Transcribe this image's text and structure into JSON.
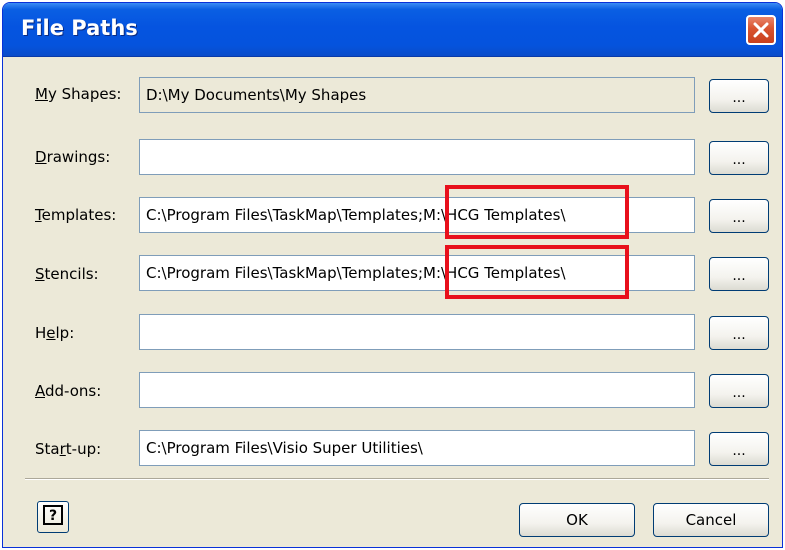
{
  "window": {
    "title": "File Paths"
  },
  "rows": [
    {
      "label": "My Shapes:",
      "value": "D:\\My Documents\\My Shapes",
      "browse": "...",
      "readonly": true
    },
    {
      "label": "Drawings:",
      "value": "",
      "browse": "..."
    },
    {
      "label": "Templates:",
      "value": "C:\\Program Files\\TaskMap\\Templates;M:\\HCG Templates\\",
      "browse": "...",
      "highlight_text": "M:\\HCG Templates\\"
    },
    {
      "label": "Stencils:",
      "value": "C:\\Program Files\\TaskMap\\Templates;M:\\HCG Templates\\",
      "browse": "...",
      "highlight_text": "M:\\HCG Templates\\"
    },
    {
      "label": "Help:",
      "value": "",
      "browse": "..."
    },
    {
      "label": "Add-ons:",
      "value": "",
      "browse": "..."
    },
    {
      "label": "Start-up:",
      "value": "C:\\Program Files\\Visio Super Utilities\\",
      "browse": "..."
    }
  ],
  "buttons": {
    "ok": "OK",
    "cancel": "Cancel"
  },
  "icons": {
    "close": "close-icon",
    "help": "help-icon"
  },
  "colors": {
    "highlight": "#e8101c",
    "titlebar": "#0554e0",
    "dialog_bg": "#ece9d8"
  }
}
